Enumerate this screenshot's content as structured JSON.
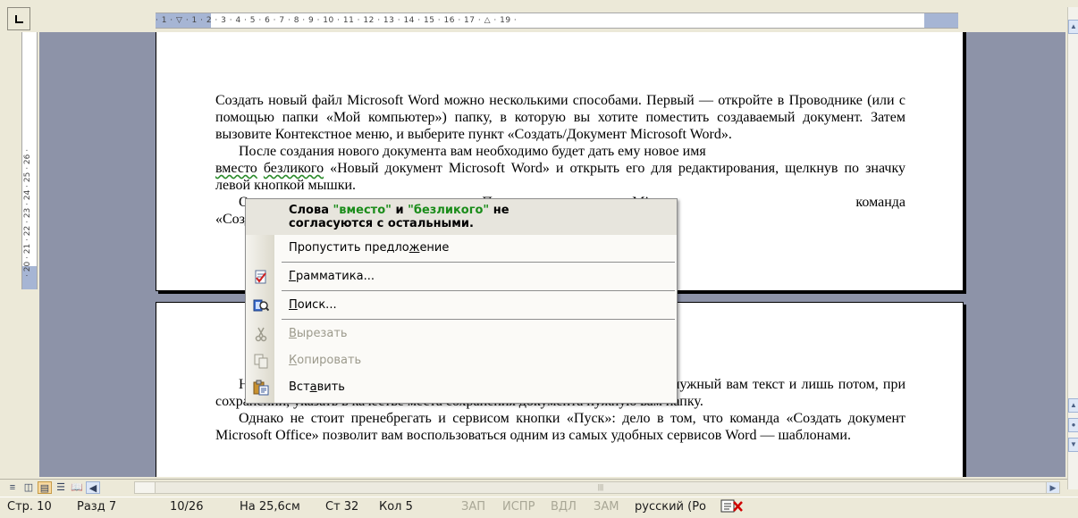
{
  "ruler": {
    "horizontal_ticks": "· 1 · ▽ · 1 · 2 · 3 · 4 · 5 · 6 · 7 · 8 · 9 · 10 · 11 · 12 · 13 · 14 · 15 · 16 · 17 · △ · 19 ·",
    "vertical_ticks": "· 20 · 21 · 22 · 23 · 24 · 25 · 26 ·"
  },
  "document": {
    "page1": {
      "para1": "Создать новый файл Microsoft Word можно несколькими способами. Первый — откройте в Проводнике (или с помощью папки «Мой компьютер») папку, в которую вы хотите поместить создаваемый документ. Затем вызовите Контекстное меню, и выберите пункт «Создать/Документ Microsoft Word».",
      "para2_a": "После создания нового документа вам необходимо будет дать ему новое имя ",
      "para2_flag1": "вместо",
      "para2_flag2": "безликого",
      "para2_b": " «Новый документ Microsoft Word» и открыть его для редактирования, щелкнув по значку левой кнопкой мышки.",
      "para3": "О                                                          ки «Пуск»: после установки Mic                                                        команда «Создать документ Off"
    },
    "page2": {
      "para1": "Н                                                      soft Word, напечатать в нем нужный вам текст и лишь потом, при сохранении, указать в качестве места сохранения документа нужную вам папку.",
      "para2": "Однако не стоит пренебрегать и сервисом кнопки «Пуск»: дело в том, что команда «Создать документ Microsoft Office» позволит вам воспользоваться одним из самых удобных сервисов Word — шаблонами."
    }
  },
  "context_menu": {
    "header_prefix": "Слова ",
    "header_word1": "\"вместо\"",
    "header_mid": " и ",
    "header_word2": "\"безликого\"",
    "header_suffix": " не",
    "header_line2": "согласуются с остальными.",
    "items": [
      {
        "label_pre": "Пропустить предло",
        "label_u": "ж",
        "label_post": "ение",
        "icon": "none",
        "disabled": false
      },
      {
        "label_pre": "",
        "label_u": "Г",
        "label_post": "рамматика...",
        "icon": "grammar-icon",
        "disabled": false
      },
      {
        "label_pre": "",
        "label_u": "П",
        "label_post": "оиск...",
        "icon": "research-icon",
        "disabled": false
      },
      {
        "label_pre": "",
        "label_u": "В",
        "label_post": "ырезать",
        "icon": "cut-icon",
        "disabled": true
      },
      {
        "label_pre": "",
        "label_u": "К",
        "label_post": "опировать",
        "icon": "copy-icon",
        "disabled": true
      },
      {
        "label_pre": "Вст",
        "label_u": "а",
        "label_post": "вить",
        "icon": "paste-icon",
        "disabled": false
      }
    ]
  },
  "statusbar": {
    "page": "Стр. 10",
    "section": "Разд 7",
    "page_of": "10/26",
    "position": "На 25,6см",
    "line": "Ст 32",
    "column": "Кол 5",
    "rec": "ЗАП",
    "trk": "ИСПР",
    "ext": "ВДЛ",
    "ovr": "ЗАМ",
    "language": "русский (Ро"
  },
  "colors": {
    "desktop": "#8d93a8",
    "grammar_flag": "#1a8c1a",
    "chrome": "#ece9d8"
  }
}
